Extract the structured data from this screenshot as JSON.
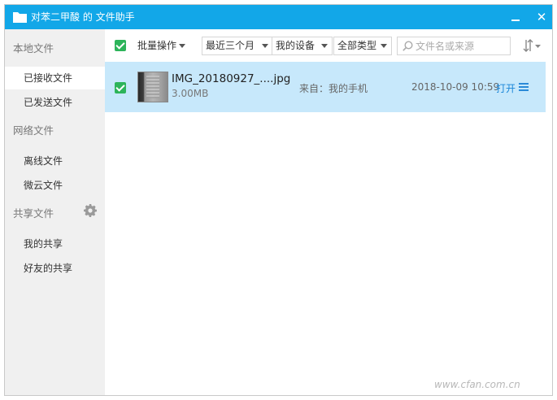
{
  "window": {
    "title": "对苯二甲酸 的 文件助手"
  },
  "sidebar": {
    "sections": [
      {
        "label": "本地文件",
        "items": [
          {
            "label": "已接收文件",
            "active": true
          },
          {
            "label": "已发送文件",
            "active": false
          }
        ]
      },
      {
        "label": "网络文件",
        "items": [
          {
            "label": "离线文件",
            "active": false
          },
          {
            "label": "微云文件",
            "active": false
          }
        ]
      },
      {
        "label": "共享文件",
        "items": [
          {
            "label": "我的共享",
            "active": false
          },
          {
            "label": "好友的共享",
            "active": false
          }
        ]
      }
    ]
  },
  "toolbar": {
    "batch_label": "批量操作",
    "time_filter": "最近三个月",
    "device_filter": "我的设备",
    "type_filter": "全部类型",
    "search_placeholder": "文件名或来源"
  },
  "files": [
    {
      "name": "IMG_20180927_....jpg",
      "size": "3.00MB",
      "source": "来自：我的手机",
      "time": "2018-10-09 10:59",
      "open_label": "打开",
      "checked": true
    }
  ],
  "watermark": "www.cfan.com.cn",
  "colors": {
    "titlebar": "#12a7e8",
    "selected_row": "#c7e8fb",
    "checkbox": "#2db45a",
    "link": "#1a86d8"
  }
}
